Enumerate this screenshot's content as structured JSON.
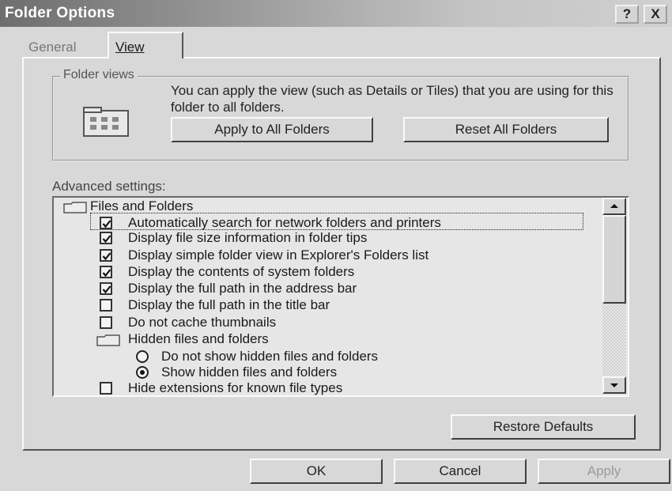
{
  "window": {
    "title": "Folder Options",
    "help_label": "?",
    "close_label": "X"
  },
  "tabs": [
    {
      "label": "General",
      "active": false
    },
    {
      "label": "View",
      "active": true
    }
  ],
  "folder_views": {
    "group_label": "Folder views",
    "description": "You can apply the view (such as Details or Tiles) that you are using for this folder to all folders.",
    "apply_button": "Apply to All Folders",
    "reset_button": "Reset All Folders"
  },
  "advanced": {
    "label": "Advanced settings:",
    "items": [
      {
        "type": "folder",
        "label": "Files and Folders"
      },
      {
        "type": "checkbox",
        "checked": true,
        "label": "Automatically search for network folders and printers"
      },
      {
        "type": "checkbox",
        "checked": true,
        "label": "Display file size information in folder tips"
      },
      {
        "type": "checkbox",
        "checked": true,
        "label": "Display simple folder view in Explorer's Folders list"
      },
      {
        "type": "checkbox",
        "checked": true,
        "label": "Display the contents of system folders"
      },
      {
        "type": "checkbox",
        "checked": true,
        "label": "Display the full path in the address bar"
      },
      {
        "type": "checkbox",
        "checked": false,
        "label": "Display the full path in the title bar"
      },
      {
        "type": "checkbox",
        "checked": false,
        "label": "Do not cache thumbnails"
      },
      {
        "type": "folder",
        "label": "Hidden files and folders"
      },
      {
        "type": "radio",
        "selected": false,
        "label": "Do not show hidden files and folders"
      },
      {
        "type": "radio",
        "selected": true,
        "label": "Show hidden files and folders"
      },
      {
        "type": "checkbox",
        "checked": false,
        "label": "Hide extensions for known file types"
      }
    ],
    "restore_button": "Restore Defaults"
  },
  "footer": {
    "ok": "OK",
    "cancel": "Cancel",
    "apply": "Apply",
    "apply_enabled": false
  },
  "colors": {
    "title_dark": "#6e6e6e",
    "face": "#d8d8d8",
    "list_bg": "#e6e6e6"
  }
}
